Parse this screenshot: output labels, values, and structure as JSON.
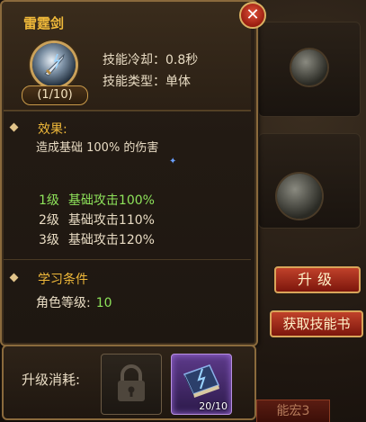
{
  "skill": {
    "name": "雷霆剑",
    "level_badge": "(1/10)",
    "cooldown": "技能冷却：0.8秒",
    "type": "技能类型：单体"
  },
  "effect": {
    "heading": "效果:",
    "description": "造成基础 100% 的伤害"
  },
  "levels": [
    {
      "level": "1级",
      "stat": "基础攻击100%",
      "current": true
    },
    {
      "level": "2级",
      "stat": "基础攻击110%",
      "current": false
    },
    {
      "level": "3级",
      "stat": "基础攻击120%",
      "current": false
    }
  ],
  "requirement": {
    "heading": "学习条件",
    "label": "角色等级:",
    "value": "10"
  },
  "buttons": {
    "upgrade": "升级",
    "get_book": "获取技能书",
    "close": "✕"
  },
  "cost": {
    "label": "升级消耗:",
    "book_count": "20/10"
  },
  "background": {
    "tab_label": "能宏3"
  },
  "colors": {
    "title_gold": "#f0b93a",
    "current_green": "#8ee35a",
    "button_red": "#c0412a",
    "rare_purple": "#5d3a8a"
  }
}
